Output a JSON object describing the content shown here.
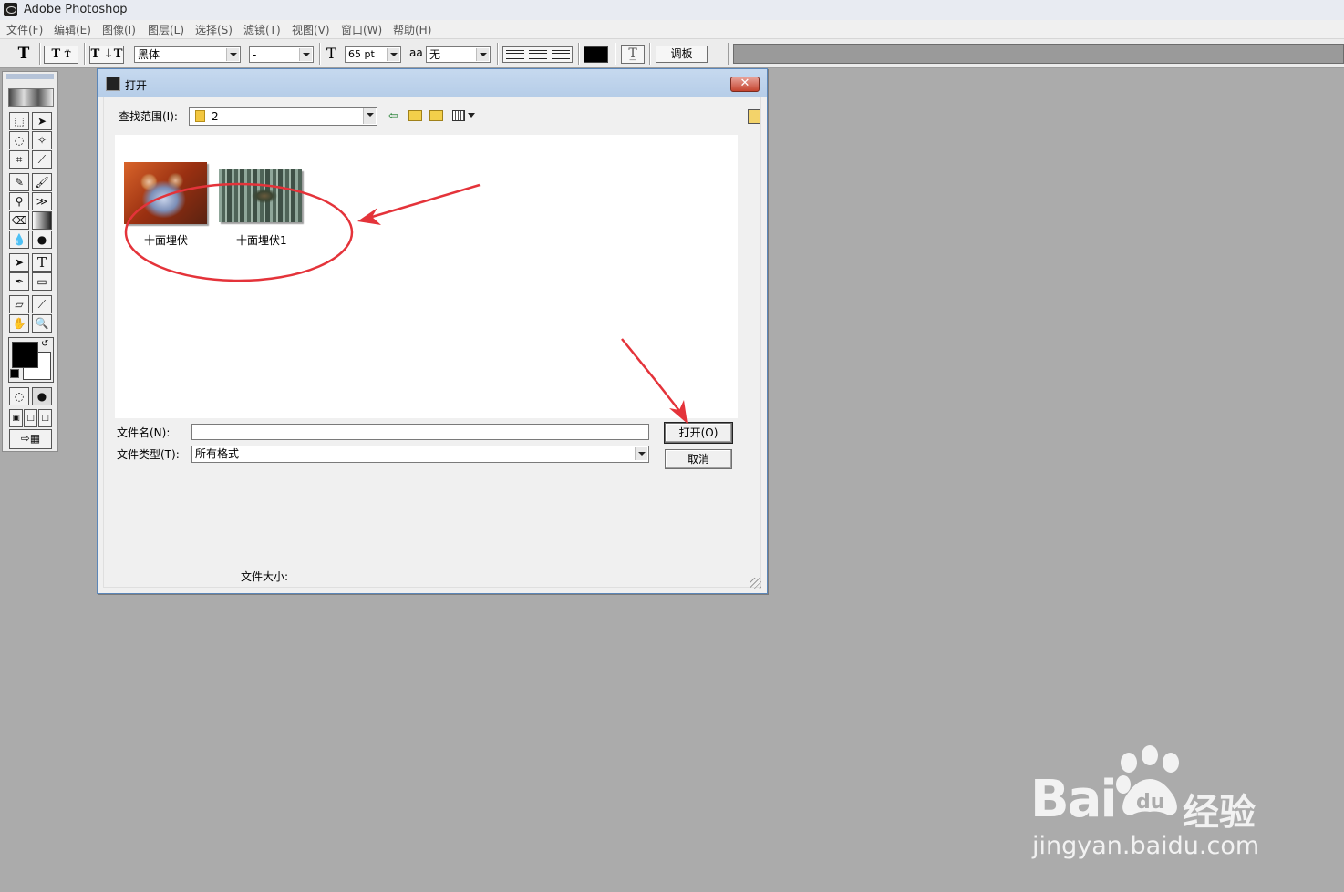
{
  "app": {
    "title": "Adobe Photoshop"
  },
  "menu": [
    "文件(F)",
    "编辑(E)",
    "图像(I)",
    "图层(L)",
    "选择(S)",
    "滤镜(T)",
    "视图(V)",
    "窗口(W)",
    "帮助(H)"
  ],
  "options": {
    "tool_glyph": "T",
    "font_family": "黑体",
    "font_style": "-",
    "font_size": "65 pt",
    "antialias_prefix": "aa",
    "antialias": "无",
    "palettes_button": "调板"
  },
  "dialog": {
    "title": "打开",
    "close_glyph": "✕",
    "look_in_label": "查找范围(I):",
    "look_in_value": "2",
    "files": [
      {
        "name": "十面埋伏"
      },
      {
        "name": "十面埋伏1"
      }
    ],
    "filename_label": "文件名(N):",
    "filename_value": "",
    "filetype_label": "文件类型(T):",
    "filetype_value": "所有格式",
    "open_button": "打开(O)",
    "cancel_button": "取消",
    "filesize_label": "文件大小:"
  },
  "icons": {
    "back": "⇦",
    "up_folder": "📁",
    "new_folder": "✳",
    "view_menu": "▦▾"
  },
  "colors": {
    "annotation": "#e4333a",
    "foreground": "#000000",
    "background": "#ffffff"
  },
  "watermark": {
    "brand": "Bai",
    "brand_cn": "经验",
    "url": "jingyan.baidu.com",
    "paw_text": "du"
  }
}
